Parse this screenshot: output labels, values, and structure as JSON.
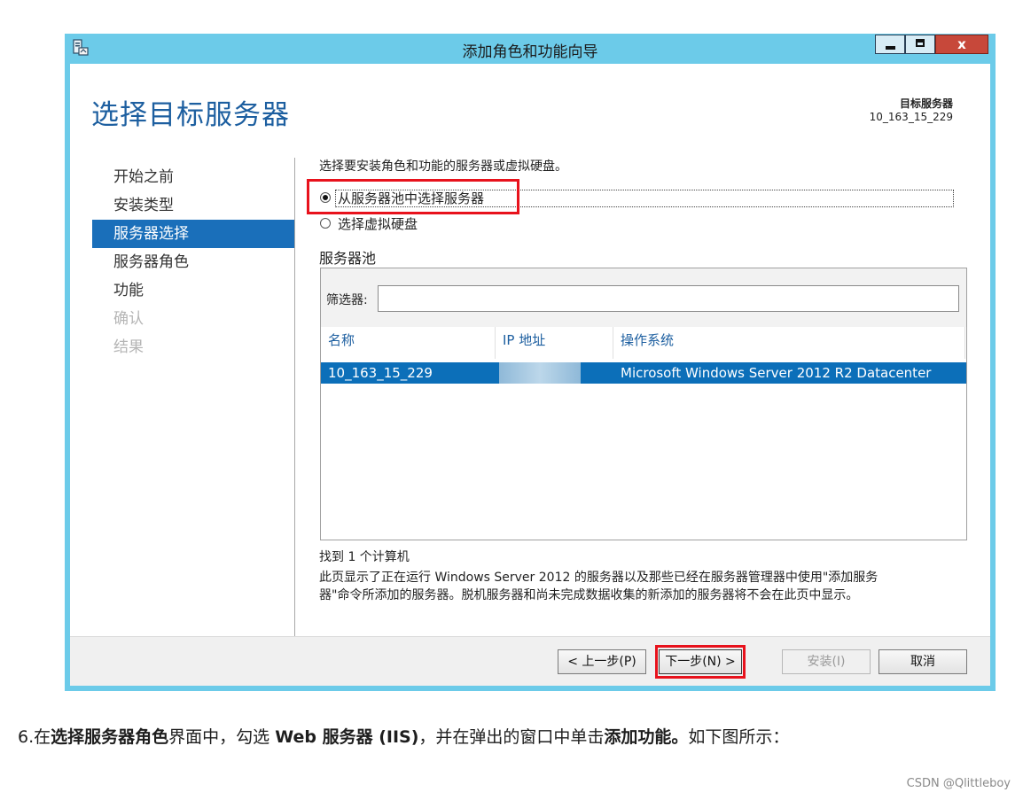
{
  "window": {
    "title": "添加角色和功能向导",
    "icon": "server-manager-icon",
    "controls": {
      "minimize": "minimize-icon",
      "maximize": "maximize-icon",
      "close": "x"
    }
  },
  "header": {
    "page_title": "选择目标服务器",
    "dest_label": "目标服务器",
    "dest_value": "10_163_15_229"
  },
  "nav": {
    "items": [
      {
        "label": "开始之前",
        "state": "normal"
      },
      {
        "label": "安装类型",
        "state": "normal"
      },
      {
        "label": "服务器选择",
        "state": "active"
      },
      {
        "label": "服务器角色",
        "state": "normal"
      },
      {
        "label": "功能",
        "state": "normal"
      },
      {
        "label": "确认",
        "state": "disabled"
      },
      {
        "label": "结果",
        "state": "disabled"
      }
    ]
  },
  "content": {
    "instruction": "选择要安装角色和功能的服务器或虚拟硬盘。",
    "options": [
      {
        "label": "从服务器池中选择服务器",
        "checked": true
      },
      {
        "label": "选择虚拟硬盘",
        "checked": false
      }
    ],
    "pool_label": "服务器池",
    "filter_label": "筛选器:",
    "filter_value": "",
    "columns": [
      "名称",
      "IP 地址",
      "操作系统"
    ],
    "rows": [
      {
        "name": "10_163_15_229",
        "ip": "",
        "os": "Microsoft Windows Server 2012 R2 Datacenter"
      }
    ],
    "found_text": "找到 1 个计算机",
    "description_line1": "此页显示了正在运行 Windows Server 2012 的服务器以及那些已经在服务器管理器中使用\"添加服务",
    "description_line2": "器\"命令所添加的服务器。脱机服务器和尚未完成数据收集的新添加的服务器将不会在此页中显示。"
  },
  "footer": {
    "prev_label": "< 上一步(P)",
    "next_label": "下一步(N) >",
    "install_label": "安装(I)",
    "cancel_label": "取消"
  },
  "article": {
    "prefix": "6.在",
    "b1": "选择服务器角色",
    "mid1": "界面中，勾选 ",
    "b2": "Web 服务器 (IIS)",
    "mid2": "，并在弹出的窗口中单击",
    "b3": "添加功能。",
    "suffix": "如下图所示："
  },
  "watermark": "CSDN @Qlittleboy",
  "colors": {
    "frame": "#6ccbe9",
    "accent": "#1a6fba",
    "title_blue": "#1d5fa0",
    "highlight_red": "#e8121c"
  }
}
